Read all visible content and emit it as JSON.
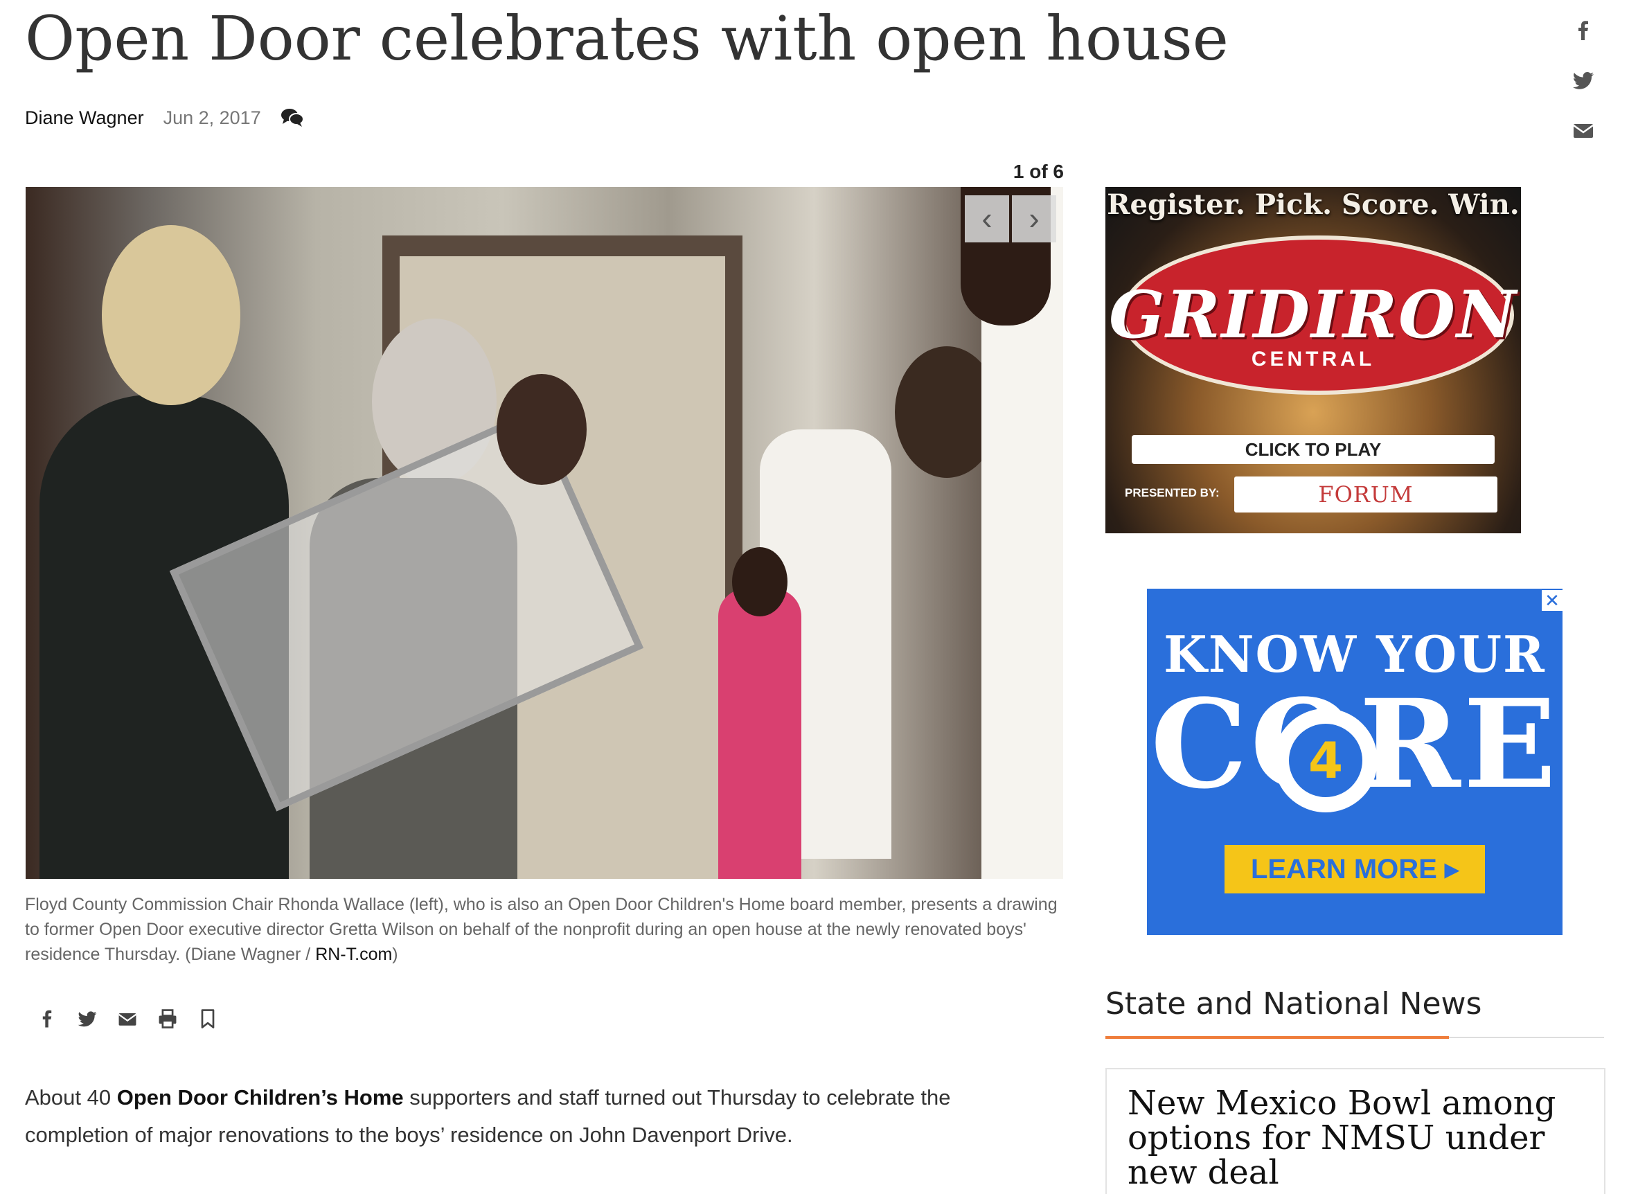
{
  "article": {
    "headline": "Open Door celebrates with open house",
    "author": "Diane Wagner",
    "date": "Jun 2, 2017",
    "comments_icon": "comments-icon"
  },
  "share_sidebar": [
    "facebook-icon",
    "twitter-icon",
    "email-icon"
  ],
  "gallery": {
    "counter": "1 of 6",
    "prev_icon": "chevron-left-icon",
    "next_icon": "chevron-right-icon",
    "caption": "Floyd County Commission Chair Rhonda Wallace (left), who is also an Open Door Children's Home board member, presents a drawing to former Open Door executive director Gretta Wilson on behalf of the nonprofit during an open house at the newly renovated boys' residence Thursday. (Diane Wagner / ",
    "caption_link": "RN-T.com",
    "caption_end": ")"
  },
  "share_row": [
    "facebook-icon",
    "twitter-icon",
    "email-icon",
    "print-icon",
    "bookmark-icon"
  ],
  "body": {
    "p1_start": "About 40 ",
    "p1_bold": "Open Door Children’s Home",
    "p1_end": " supporters and staff turned out Thursday to celebrate the completion of major renovations to the boys’ residence on John Davenport Drive."
  },
  "ad1": {
    "tagline": "Register. Pick. Score. Win.",
    "brand": "GRIDIRON",
    "sub": "CENTRAL",
    "cta": "CLICK TO PLAY",
    "presented_by": "PRESENTED BY:",
    "sponsor": "FORUM"
  },
  "ad2": {
    "line1": "KNOW YOUR",
    "line2": "CORE",
    "badge": "4",
    "cta": "LEARN MORE ▸",
    "close": "✕"
  },
  "sidebar": {
    "section_title": "State and National News",
    "news_title": "New Mexico Bowl among options for NMSU under new deal"
  },
  "colors": {
    "accent": "#ef7d3b",
    "ad2_blue": "#2a6fdb",
    "ad2_yellow": "#f5c518",
    "ad1_red": "#c8232c"
  }
}
